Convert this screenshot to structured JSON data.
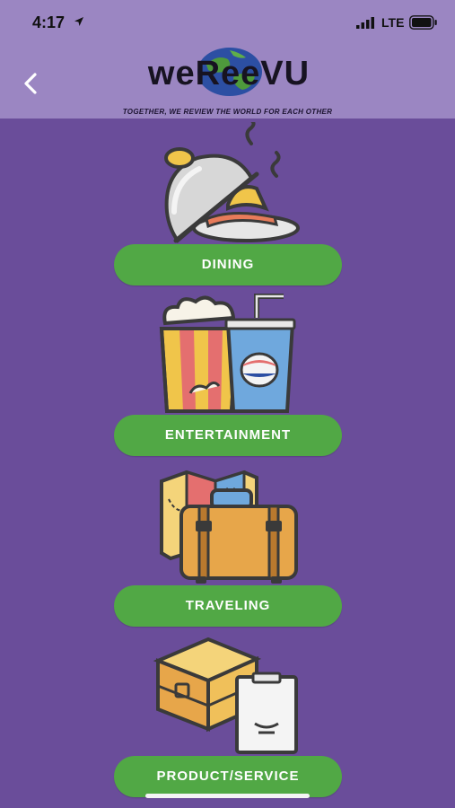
{
  "status_bar": {
    "time": "4:17",
    "network": "LTE"
  },
  "header": {
    "logo_text": "weReeVU",
    "tagline": "TOGETHER, WE REVIEW THE WORLD FOR EACH OTHER"
  },
  "categories": [
    {
      "label": "DINING",
      "icon": "dining-icon"
    },
    {
      "label": "ENTERTAINMENT",
      "icon": "entertainment-icon"
    },
    {
      "label": "TRAVELING",
      "icon": "traveling-icon"
    },
    {
      "label": "PRODUCT/SERVICE",
      "icon": "product-service-icon"
    }
  ],
  "colors": {
    "background": "#6a4d9a",
    "header": "#9b86c2",
    "button": "#51a845",
    "button_text": "#ffffff"
  }
}
